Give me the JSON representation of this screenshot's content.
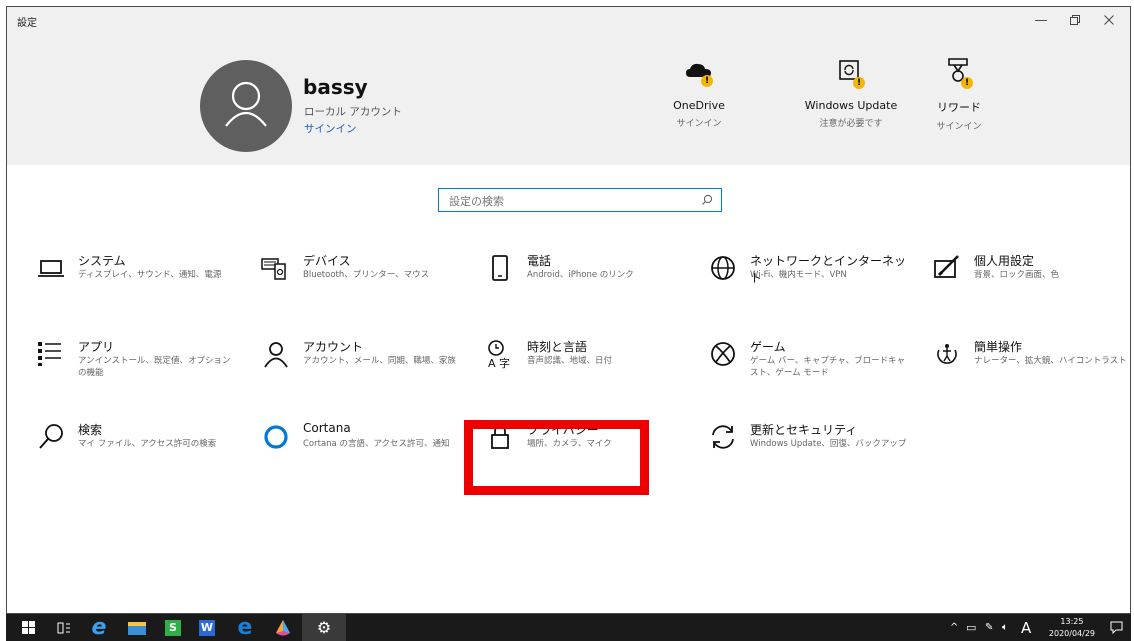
{
  "window": {
    "title": "設定",
    "controls": [
      "minimize-icon",
      "restore-icon",
      "close-icon"
    ]
  },
  "account": {
    "name": "bassy",
    "type": "ローカル アカウント",
    "signin_link": "サインイン"
  },
  "header_status": [
    {
      "name": "OneDrive",
      "status": "サインイン",
      "icon": "onedrive-icon"
    },
    {
      "name": "Windows Update",
      "status": "注意が必要です",
      "icon": "windows-update-icon"
    },
    {
      "name": "リワード",
      "status": "サインイン",
      "icon": "rewards-icon"
    }
  ],
  "search": {
    "placeholder": "設定の検索"
  },
  "categories": [
    {
      "title": "システム",
      "desc": "ディスプレイ、サウンド、通知、電源",
      "icon": "laptop-icon"
    },
    {
      "title": "デバイス",
      "desc": "Bluetooth、プリンター、マウス",
      "icon": "devices-icon"
    },
    {
      "title": "電話",
      "desc": "Android、iPhone のリンク",
      "icon": "phone-icon"
    },
    {
      "title": "ネットワークとインターネット",
      "desc": "Wi-Fi、機内モード、VPN",
      "icon": "globe-icon"
    },
    {
      "title": "個人用設定",
      "desc": "背景、ロック画面、色",
      "icon": "personalization-icon"
    },
    {
      "title": "アプリ",
      "desc": "アンインストール、既定値、オプションの機能",
      "icon": "apps-icon"
    },
    {
      "title": "アカウント",
      "desc": "アカウント、メール、同期、職場、家族",
      "icon": "person-icon"
    },
    {
      "title": "時刻と言語",
      "desc": "音声認識、地域、日付",
      "icon": "time-language-icon"
    },
    {
      "title": "ゲーム",
      "desc": "ゲーム バー、キャプチャ、ブロードキャスト、ゲーム モード",
      "icon": "xbox-icon"
    },
    {
      "title": "簡単操作",
      "desc": "ナレーター、拡大鏡、ハイコントラスト",
      "icon": "ease-of-access-icon"
    },
    {
      "title": "検索",
      "desc": "マイ ファイル、アクセス許可の検索",
      "icon": "search-icon"
    },
    {
      "title": "Cortana",
      "desc": "Cortana の言語、アクセス許可、通知",
      "icon": "cortana-icon"
    },
    {
      "title": "プライバシー",
      "desc": "場所、カメラ、マイク",
      "icon": "lock-icon"
    },
    {
      "title": "更新とセキュリティ",
      "desc": "Windows Update、回復、バックアップ",
      "icon": "sync-icon"
    }
  ],
  "highlight": {
    "target": "プライバシー",
    "color": "#ee0000"
  },
  "taskbar": {
    "apps": [
      "windows-start-icon",
      "task-view-icon",
      "internet-explorer-icon",
      "file-explorer-icon",
      "green-app-icon",
      "word-app-icon",
      "edge-icon",
      "colorful-app-icon",
      "settings-gear-icon"
    ],
    "tray": {
      "ime": "A",
      "time": "13:25",
      "date": "2020/04/29"
    }
  },
  "colors": {
    "accent": "#0078d4",
    "link": "#1a5fb4",
    "warning": "#f2b705",
    "header_bg": "#f0f0f0",
    "taskbar_bg": "#1a1a1a"
  }
}
